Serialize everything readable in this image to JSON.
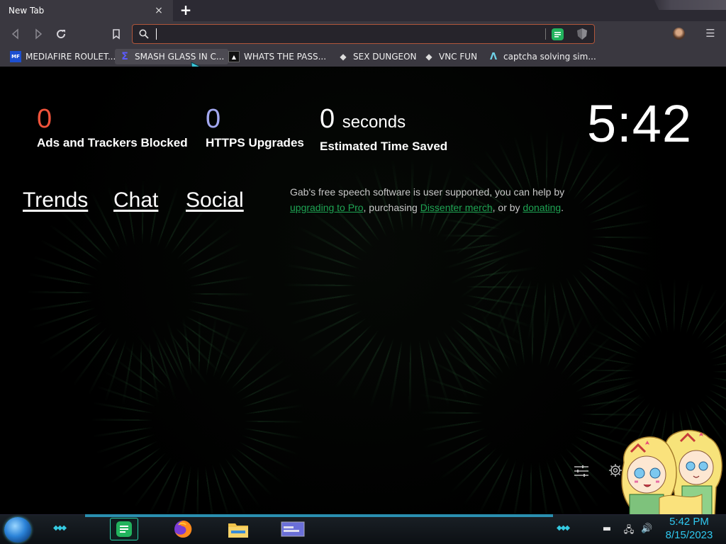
{
  "browser": {
    "tab": {
      "title": "New Tab",
      "close": "×"
    },
    "new_tab": "+",
    "address": {
      "value": "",
      "placeholder": ""
    },
    "menu": "☰"
  },
  "bookmarks": [
    {
      "label": "MEDIAFIRE ROULET...",
      "icon": "MF",
      "icon_name": "mediafire-icon",
      "color": "#1c4fd1"
    },
    {
      "label": "SMASH GLASS IN C...",
      "icon": "Σ",
      "icon_name": "sigma-icon",
      "color": "#3b3bd1"
    },
    {
      "label": "WHATS THE PASS...",
      "icon": "▲",
      "icon_name": "lock-site-icon",
      "color": "#222"
    },
    {
      "label": "SEX DUNGEON",
      "icon": "◆",
      "icon_name": "cube-icon",
      "color": "#444"
    },
    {
      "label": "VNC FUN",
      "icon": "◆",
      "icon_name": "cube-icon",
      "color": "#444"
    },
    {
      "label": "captcha solving sim...",
      "icon": "Λ",
      "icon_name": "lambda-icon",
      "color": "#1a6f8a"
    }
  ],
  "stats": {
    "ads": {
      "value": "0",
      "label": "Ads and Trackers Blocked",
      "color": "#f0533b"
    },
    "https": {
      "value": "0",
      "label": "HTTPS Upgrades",
      "color": "#a3a8f0"
    },
    "time": {
      "value": "0",
      "unit": "seconds",
      "label": "Estimated Time Saved",
      "color": "#ffffff"
    }
  },
  "clock": "5:42",
  "links": {
    "trends": "Trends",
    "chat": "Chat",
    "social": "Social"
  },
  "gab": {
    "part1": "Gab's free speech software is user supported, you can help by ",
    "link1": "upgrading to Pro",
    "part2": ", purchasing ",
    "link2": "Dissenter merch",
    "part3": ", or by ",
    "link3": "donating",
    "part4": "."
  },
  "taskbar": {
    "time": "5:42 PM",
    "date": "8/15/2023",
    "accent": "#2fc9f0"
  }
}
